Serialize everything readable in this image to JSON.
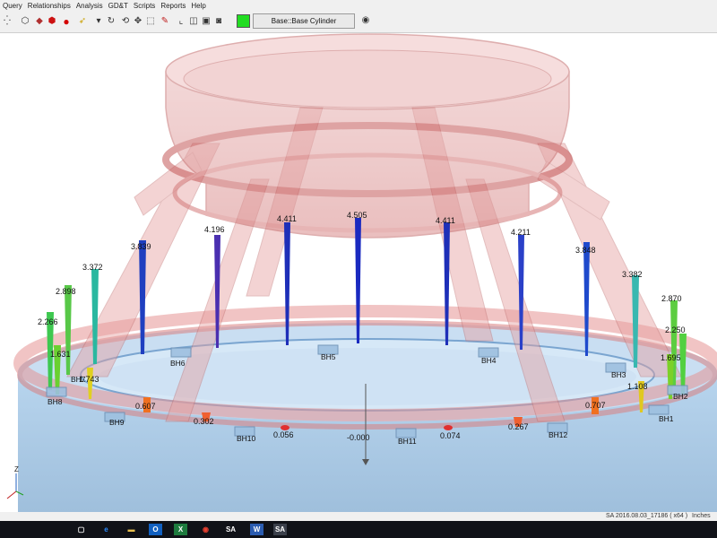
{
  "menu": [
    "Query",
    "Relationships",
    "Analysis",
    "GD&T",
    "Scripts",
    "Reports",
    "Help"
  ],
  "toolbar": {
    "icons": [
      "grid-icon",
      "cube-icon",
      "shape-icon",
      "record-icon",
      "pointer-icon",
      "refresh-icon",
      "move-icon",
      "select-icon",
      "probe-icon",
      "frame-icon",
      "box-icon",
      "layers-icon",
      "camera-icon"
    ],
    "active_object": "Base::Base Cylinder",
    "color_swatch": "#22dd22"
  },
  "viewport": {
    "deviations": [
      "3.839",
      "4.196",
      "4.411",
      "4.505",
      "4.411",
      "4.211",
      "3.848",
      "3.372",
      "3.382",
      "2.898",
      "2.870",
      "2.266",
      "2.250",
      "1.631",
      "1.695",
      "1.743",
      "1.108",
      "0.607",
      "0.707",
      "0.302",
      "0.267",
      "0.056",
      "0.074",
      "-0.000"
    ],
    "points": [
      "BH1",
      "BH2",
      "BH3",
      "BH4",
      "BH5",
      "BH6",
      "BH7",
      "BH8",
      "BH9",
      "BH10",
      "BH11",
      "BH12"
    ],
    "axis_label": "Z"
  },
  "status": {
    "version": "SA 2016.08.03_17186 ( x64 )",
    "units": "Inches"
  },
  "taskbar": [
    "task-view-icon",
    "edge-icon",
    "file-explorer-icon",
    "outlook-icon",
    "excel-icon",
    "chrome-icon",
    "sa-icon",
    "word-icon",
    "sa-active-icon"
  ]
}
